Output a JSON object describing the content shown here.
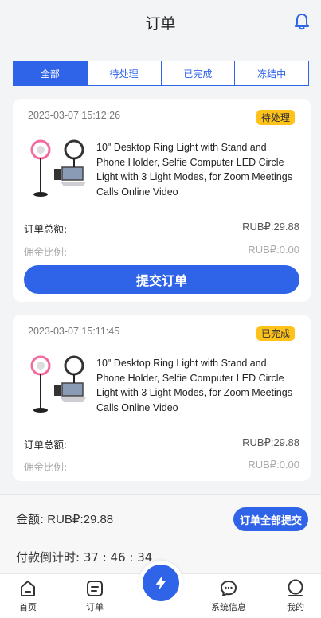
{
  "header": {
    "title": "订单"
  },
  "tabs": [
    {
      "label": "全部",
      "active": true
    },
    {
      "label": "待处理",
      "active": false
    },
    {
      "label": "已完成",
      "active": false
    },
    {
      "label": "冻结中",
      "active": false
    }
  ],
  "orders": [
    {
      "time": "2023-03-07 15:12:26",
      "status": "待处理",
      "product": "10\" Desktop Ring Light with Stand and Phone Holder, Selfie Computer LED Circle Light with 3 Light Modes, for Zoom Meetings Calls Online Video",
      "total_label": "订单总额:",
      "total_value": "RUB₽:29.88",
      "commission_label": "佣金比例:",
      "commission_value": "RUB₽:0.00",
      "submit_label": "提交订单"
    },
    {
      "time": "2023-03-07 15:11:45",
      "status": "已完成",
      "product": "10\" Desktop Ring Light with Stand and Phone Holder, Selfie Computer LED Circle Light with 3 Light Modes, for Zoom Meetings Calls Online Video",
      "total_label": "订单总额:",
      "total_value": "RUB₽:29.88",
      "commission_label": "佣金比例:",
      "commission_value": "RUB₽:0.00"
    }
  ],
  "summary": {
    "amount_label": "金额:",
    "amount_value": "RUB₽:29.88",
    "submit_all_label": "订单全部提交",
    "countdown_label": "付款倒计时:",
    "countdown_value": "37 : 46 : 34"
  },
  "tabbar": {
    "home": "首页",
    "orders": "订单",
    "messages": "系统信息",
    "mine": "我的"
  },
  "colors": {
    "accent": "#2f63e8",
    "badge": "#ffc21a"
  }
}
